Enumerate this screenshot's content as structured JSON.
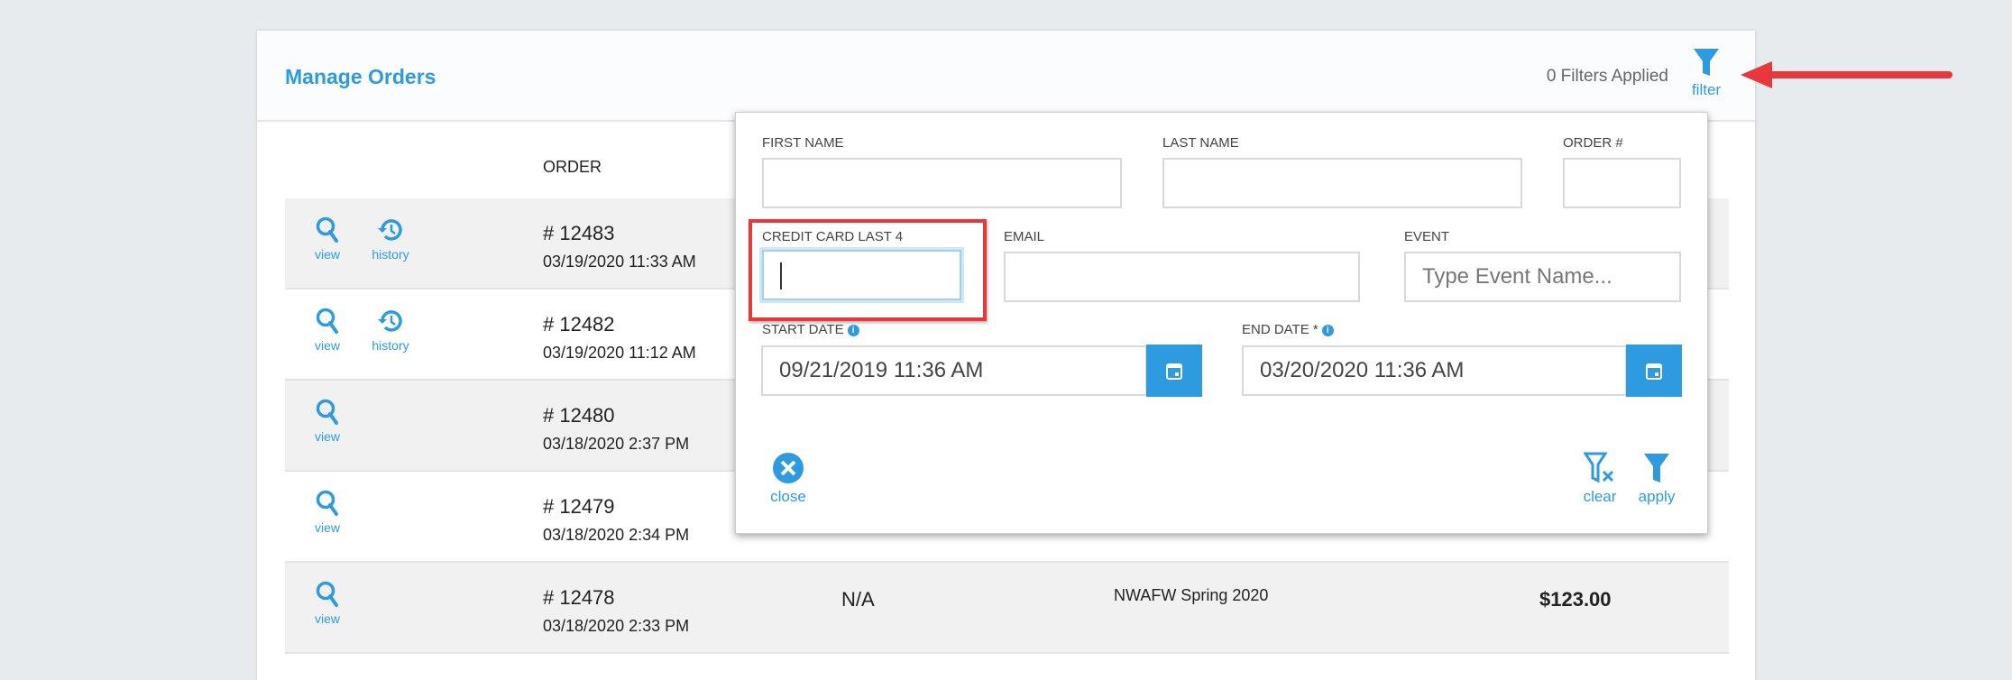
{
  "header": {
    "title": "Manage Orders",
    "filters_applied": "0 Filters Applied",
    "filter_label": "filter"
  },
  "table": {
    "columns": {
      "order": "ORDER"
    },
    "rows": [
      {
        "order": "# 12483",
        "date": "03/19/2020 11:33 AM",
        "view": "view",
        "history": "history"
      },
      {
        "order": "# 12482",
        "date": "03/19/2020 11:12 AM",
        "view": "view",
        "history": "history"
      },
      {
        "order": "# 12480",
        "date": "03/18/2020 2:37 PM",
        "view": "view"
      },
      {
        "order": "# 12479",
        "date": "03/18/2020 2:34 PM",
        "view": "view"
      },
      {
        "order": "# 12478",
        "date": "03/18/2020 2:33 PM",
        "view": "view",
        "col3": "N/A",
        "event": "NWAFW Spring 2020",
        "total": "$123.00"
      }
    ]
  },
  "filter_panel": {
    "first_name": {
      "label": "FIRST NAME",
      "value": ""
    },
    "last_name": {
      "label": "LAST NAME",
      "value": ""
    },
    "order_no": {
      "label": "ORDER #",
      "value": ""
    },
    "cc_last4": {
      "label": "CREDIT CARD LAST 4",
      "value": ""
    },
    "email": {
      "label": "EMAIL",
      "value": ""
    },
    "event": {
      "label": "EVENT",
      "placeholder": "Type Event Name..."
    },
    "start_date": {
      "label": "START DATE",
      "value": "09/21/2019 11:36 AM"
    },
    "end_date": {
      "label": "END DATE *",
      "value": "03/20/2020 11:36 AM"
    },
    "close": "close",
    "clear": "clear",
    "apply": "apply"
  },
  "colors": {
    "accent": "#2e9be0",
    "annotation": "#e8383d"
  }
}
